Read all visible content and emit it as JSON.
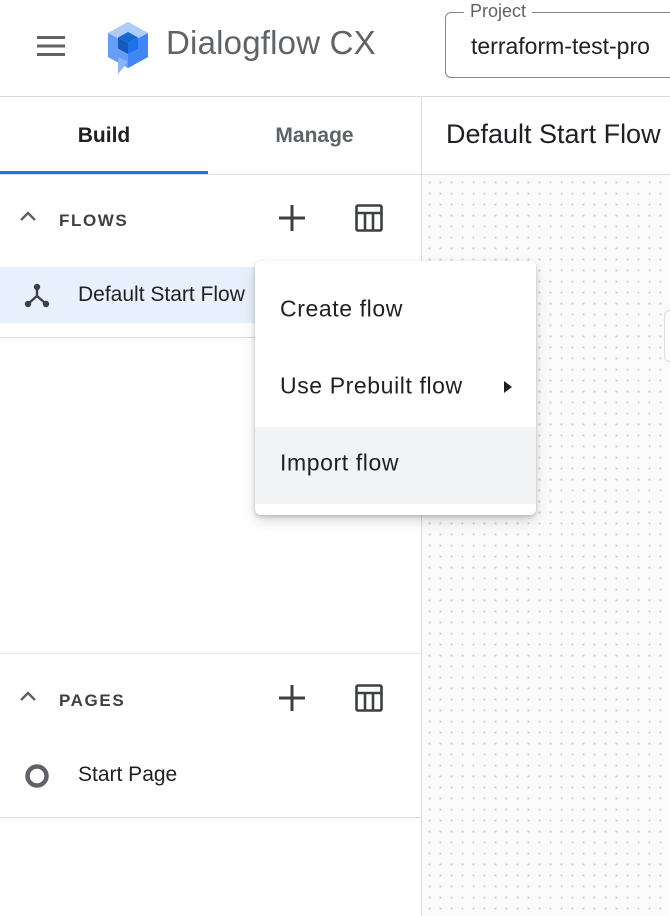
{
  "app": {
    "title": "Dialogflow CX",
    "project_label": "Project",
    "project_value": "terraform-test-pro"
  },
  "tabs": [
    {
      "label": "Build",
      "active": true
    },
    {
      "label": "Manage",
      "active": false
    }
  ],
  "flows_section": {
    "title": "FLOWS",
    "items": [
      {
        "label": "Default Start Flow"
      }
    ]
  },
  "pages_section": {
    "title": "PAGES",
    "items": [
      {
        "label": "Start Page"
      }
    ]
  },
  "canvas": {
    "title": "Default Start Flow"
  },
  "context_menu": {
    "items": [
      {
        "label": "Create flow",
        "has_submenu": false
      },
      {
        "label": "Use Prebuilt flow",
        "has_submenu": true
      },
      {
        "label": "Import flow",
        "has_submenu": false,
        "hovered": true
      }
    ]
  },
  "colors": {
    "accent": "#1a73e8",
    "selected_row": "#e8f0fe",
    "hover_row": "#f1f3f4"
  },
  "icons": {
    "menu": "hamburger-menu-icon",
    "logo": "dialogflow-logo",
    "collapse": "chevron-up-icon",
    "add": "plus-icon",
    "table": "table-icon",
    "flow": "flow-branch-icon",
    "page": "page-circle-icon",
    "submenu": "triangle-right-icon"
  }
}
